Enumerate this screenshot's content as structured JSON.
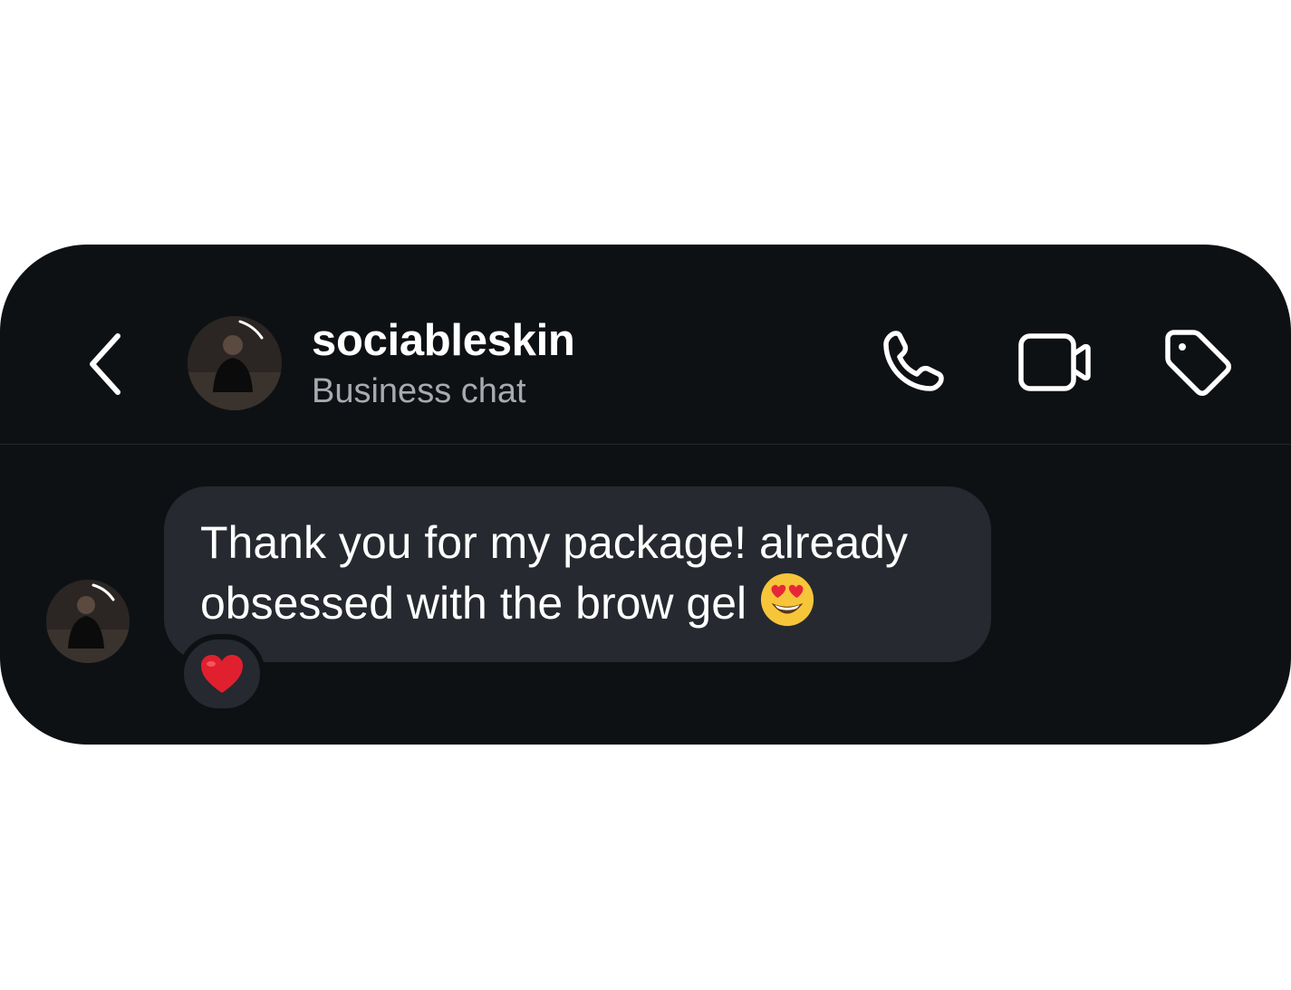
{
  "header": {
    "username": "sociableskin",
    "subtitle": "Business chat",
    "back_icon": "chevron-left-icon",
    "call_icon": "phone-icon",
    "video_icon": "video-camera-icon",
    "label_icon": "tag-icon"
  },
  "messages": [
    {
      "text": "Thank you for my package! already obsessed with the brow gel",
      "emoji": "heart-eyes-emoji",
      "reaction": "red-heart-emoji"
    }
  ],
  "colors": {
    "background": "#0e1114",
    "bubble": "#26292f",
    "text": "#ffffff",
    "subtitle": "#a7abb0"
  }
}
